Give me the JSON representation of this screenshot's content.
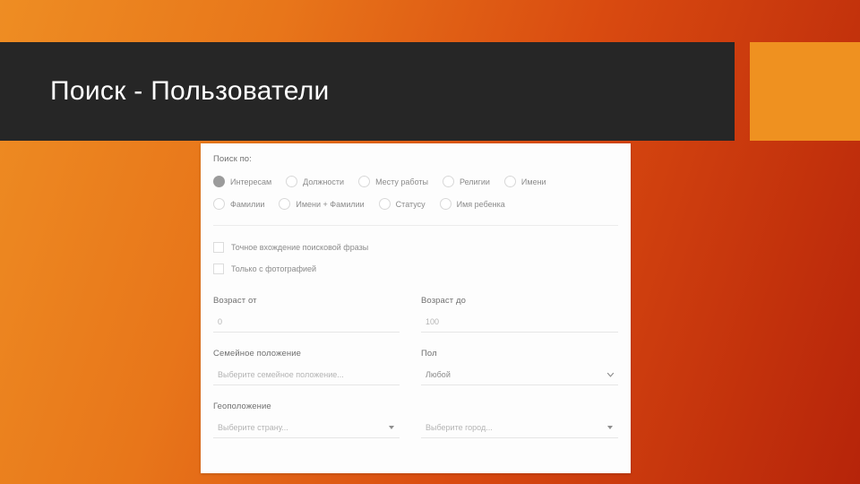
{
  "slide": {
    "title": "Поиск - Пользователи"
  },
  "form": {
    "search_by_label": "Поиск по:",
    "radio_rows": [
      [
        {
          "label": "Интересам",
          "checked": true
        },
        {
          "label": "Должности",
          "checked": false
        },
        {
          "label": "Месту работы",
          "checked": false
        },
        {
          "label": "Религии",
          "checked": false
        },
        {
          "label": "Имени",
          "checked": false
        }
      ],
      [
        {
          "label": "Фамилии",
          "checked": false
        },
        {
          "label": "Имени + Фамилии",
          "checked": false
        },
        {
          "label": "Статусу",
          "checked": false
        },
        {
          "label": "Имя ребенка",
          "checked": false
        }
      ]
    ],
    "checkboxes": [
      {
        "label": "Точное вхождение поисковой фразы",
        "checked": false
      },
      {
        "label": "Только с фотографией",
        "checked": false
      }
    ],
    "age_from": {
      "label": "Возраст от",
      "placeholder": "0"
    },
    "age_to": {
      "label": "Возраст до",
      "placeholder": "100"
    },
    "marital_status": {
      "label": "Семейное положение",
      "placeholder": "Выберите семейное положение..."
    },
    "gender": {
      "label": "Пол",
      "value": "Любой"
    },
    "geolocation": {
      "label": "Геоположение",
      "country_placeholder": "Выберите страну...",
      "city_placeholder": "Выберите город..."
    }
  },
  "colors": {
    "accent_orange": "#ef9120",
    "title_bar": "#262626",
    "panel": "#fdfdfd"
  }
}
